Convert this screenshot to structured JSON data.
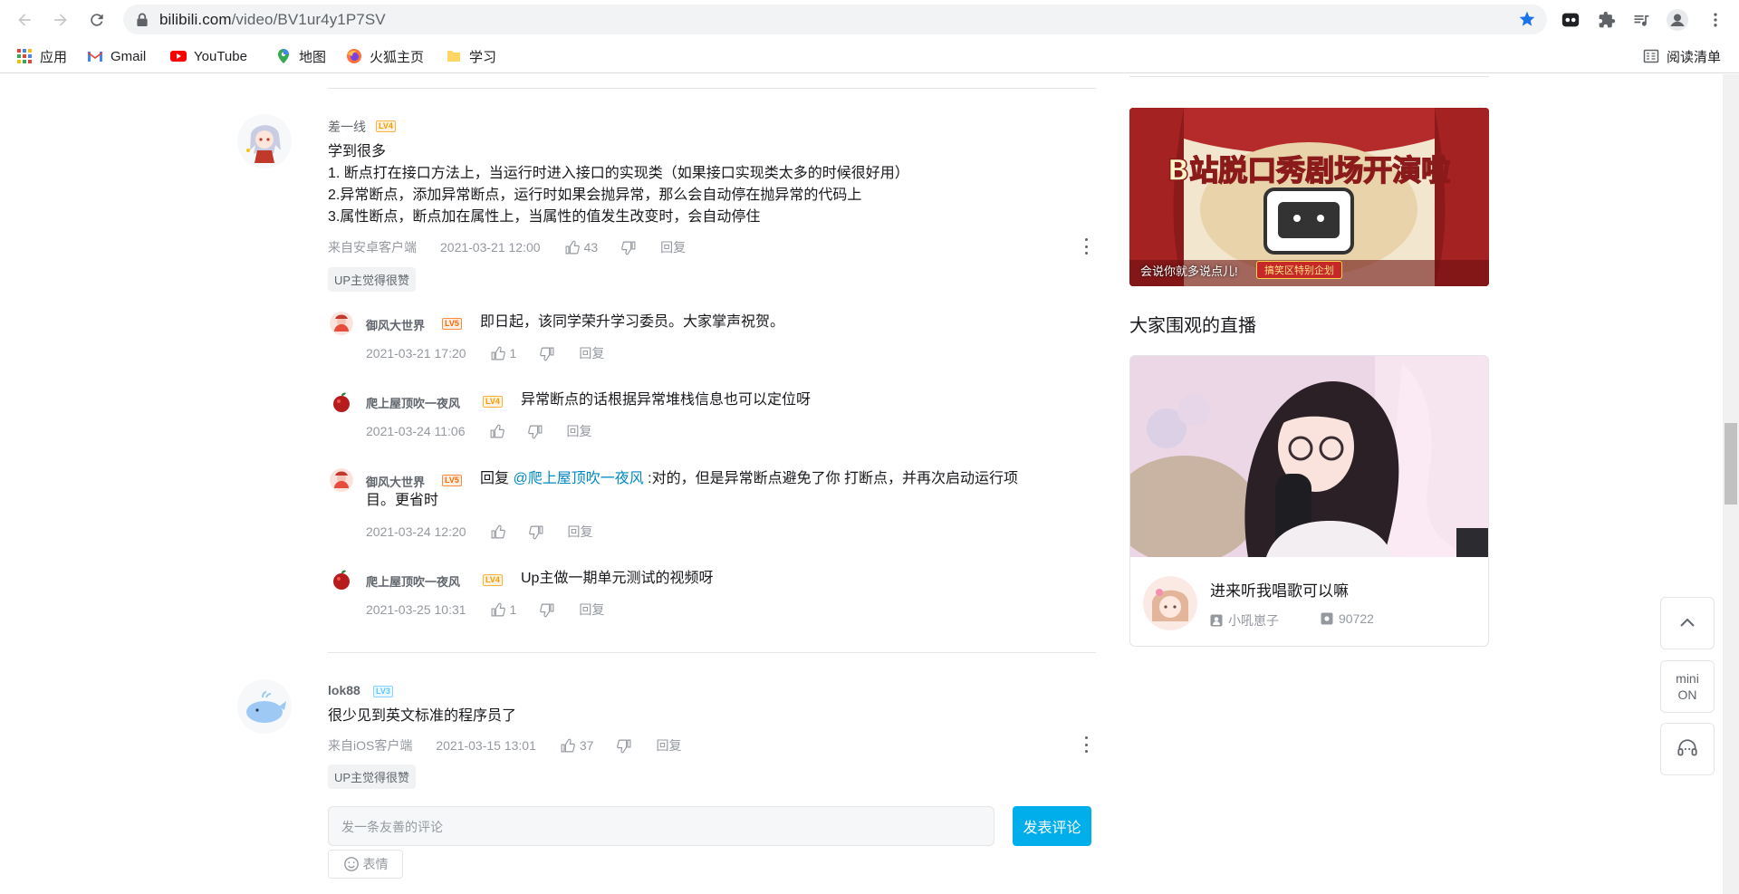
{
  "browser": {
    "url_host": "bilibili.com",
    "url_path": "/video/BV1ur4y1P7SV",
    "bookmarks": [
      {
        "label": "应用",
        "icon": "apps-grid-icon"
      },
      {
        "label": "Gmail",
        "icon": "gmail-icon"
      },
      {
        "label": "YouTube",
        "icon": "youtube-icon"
      },
      {
        "label": "地图",
        "icon": "maps-icon"
      },
      {
        "label": "火狐主页",
        "icon": "firefox-icon"
      },
      {
        "label": "学习",
        "icon": "folder-icon"
      }
    ],
    "reading_list": "阅读清单"
  },
  "comments": [
    {
      "user": "差一线",
      "level": "LV4",
      "lines": [
        "学到很多",
        "1. 断点打在接口方法上，当运行时进入接口的实现类（如果接口实现类太多的时候很好用）",
        "2.异常断点，添加异常断点，运行时如果会抛异常，那么会自动停在抛异常的代码上",
        "3.属性断点，断点加在属性上，当属性的值发生改变时，会自动停住"
      ],
      "source": "来自安卓客户端",
      "time": "2021-03-21 12:00",
      "likes": "43",
      "reply": "回复",
      "tag": "UP主觉得很赞",
      "replies": [
        {
          "user": "御风大世界",
          "level": "LV5",
          "prefix": "",
          "mention": "",
          "text": "即日起，该同学荣升学习委员。大家掌声祝贺。",
          "text2": "",
          "time": "2021-03-21 17:20",
          "likes": "1",
          "reply": "回复"
        },
        {
          "user": "爬上屋顶吹一夜风",
          "level": "LV4",
          "prefix": "",
          "mention": "",
          "text": "异常断点的话根据异常堆栈信息也可以定位呀",
          "text2": "",
          "time": "2021-03-24 11:06",
          "likes": "",
          "reply": "回复"
        },
        {
          "user": "御风大世界",
          "level": "LV5",
          "prefix": "回复 ",
          "mention": "@爬上屋顶吹一夜风",
          "text": " :对的，但是异常断点避免了你 打断点，并再次启动运行项",
          "text2": "目。更省时",
          "time": "2021-03-24 12:20",
          "likes": "",
          "reply": "回复"
        },
        {
          "user": "爬上屋顶吹一夜风",
          "level": "LV4",
          "prefix": "",
          "mention": "",
          "text": "Up主做一期单元测试的视频呀",
          "text2": "",
          "time": "2021-03-25 10:31",
          "likes": "1",
          "reply": "回复"
        }
      ]
    },
    {
      "user": "lok88",
      "level": "LV3",
      "lines": [
        "很少见到英文标准的程序员了"
      ],
      "source": "来自iOS客户端",
      "time": "2021-03-15 13:01",
      "likes": "37",
      "reply": "回复",
      "tag": "UP主觉得很赞"
    }
  ],
  "comment_box": {
    "placeholder": "发一条友善的评论",
    "send": "发表评论",
    "emoji": "表情"
  },
  "sidebar": {
    "banner_caption": "会说你就多说点儿!",
    "banner_tag": "搞笑区特别企划",
    "banner_title": "B站脱口秀剧场开演啦",
    "live_section_title": "大家围观的直播",
    "live": {
      "title": "进来听我唱歌可以嘛",
      "streamer": "小吼崽子",
      "viewers": "90722"
    }
  },
  "float": {
    "mini_label_1": "mini",
    "mini_label_2": "ON"
  },
  "colors": {
    "accent": "#00aeec",
    "link": "#008ac5",
    "meta": "#9499a0"
  }
}
